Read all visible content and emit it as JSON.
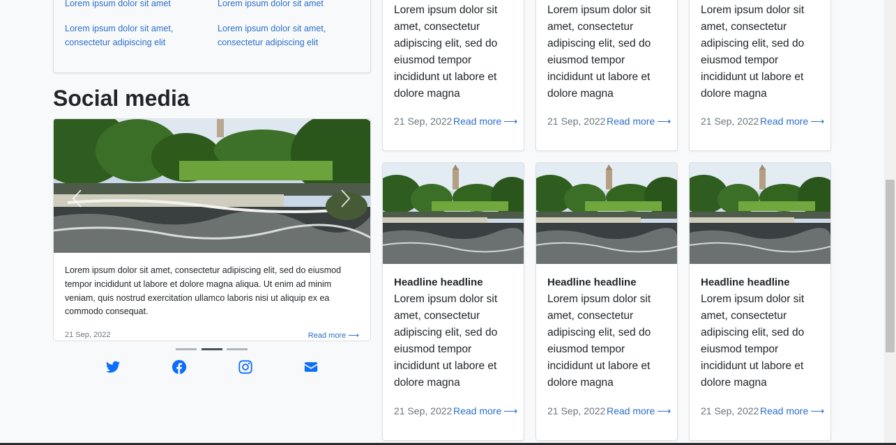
{
  "links": [
    {
      "text": "Lorem ipsum dolor sit amet"
    },
    {
      "text": "Lorem ipsum dolor sit amet"
    },
    {
      "line1": "Lorem ipsum dolor sit amet,",
      "line2": "consectetur adipiscing elit"
    },
    {
      "line1": "Lorem ipsum dolor sit amet,",
      "line2": "consectetur adipiscing elit"
    }
  ],
  "social": {
    "title": "Social media",
    "body": "Lorem ipsum dolor sit amet, consectetur adipiscing elit, sed do eiusmod tempor incididunt ut labore et dolore magna aliqua. Ut enim ad minim veniam, quis nostrud exercitation ullamco laboris nisi ut aliquip ex ea commodo consequat.",
    "date": "21 Sep, 2022",
    "read_more": "Read more",
    "carousel_active_index": 1,
    "carousel_count": 3,
    "icons": [
      "twitter-icon",
      "facebook-icon",
      "instagram-icon",
      "envelope-icon"
    ]
  },
  "news": {
    "top": [
      {
        "text_lines": [
          "Lorem ipsum dolor sit",
          "amet, consectetur",
          "adipiscing elit, sed do",
          "eiusmod tempor",
          "incididunt ut labore et",
          "dolore magna"
        ],
        "date": "21 Sep, 2022",
        "read_more": "Read more"
      },
      {
        "text_lines": [
          "Lorem ipsum dolor sit",
          "amet, consectetur",
          "adipiscing elit, sed do",
          "eiusmod tempor",
          "incididunt ut labore et",
          "dolore magna"
        ],
        "date": "21 Sep, 2022",
        "read_more": "Read more"
      },
      {
        "text_lines": [
          "Lorem ipsum dolor sit",
          "amet, consectetur",
          "adipiscing elit, sed do",
          "eiusmod tempor",
          "incididunt ut labore et",
          "dolore magna"
        ],
        "date": "21 Sep, 2022",
        "read_more": "Read more"
      }
    ],
    "bottom": [
      {
        "headline": "Headline headline",
        "text_lines": [
          "Lorem ipsum dolor sit",
          "amet, consectetur",
          "adipiscing elit, sed do",
          "eiusmod tempor",
          "incididunt ut labore et",
          "dolore magna"
        ],
        "date": "21 Sep, 2022",
        "read_more": "Read more"
      },
      {
        "headline": "Headline headline",
        "text_lines": [
          "Lorem ipsum dolor sit",
          "amet, consectetur",
          "adipiscing elit, sed do",
          "eiusmod tempor",
          "incididunt ut labore et",
          "dolore magna"
        ],
        "date": "21 Sep, 2022",
        "read_more": "Read more"
      },
      {
        "headline": "Headline headline",
        "text_lines": [
          "Lorem ipsum dolor sit",
          "amet, consectetur",
          "adipiscing elit, sed do",
          "eiusmod tempor",
          "incididunt ut labore et",
          "dolore magna"
        ],
        "date": "21 Sep, 2022",
        "read_more": "Read more"
      }
    ]
  },
  "colors": {
    "link": "#2c6fc9",
    "social_icon": "#0d6efd",
    "text": "#212529",
    "muted": "#6c757d"
  }
}
